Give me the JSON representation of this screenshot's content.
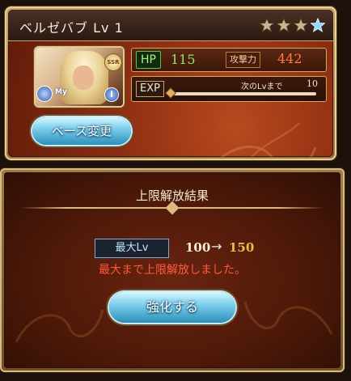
{
  "character": {
    "name": "ベルゼバブ",
    "level_text": "Lv 1",
    "stars_filled": 3,
    "stars_total": 4,
    "rarity_badge": "SSR",
    "my_badge": "My",
    "info_badge": "i"
  },
  "stats": {
    "hp_label": "HP",
    "hp_value": "115",
    "atk_label": "攻撃力",
    "atk_value": "442",
    "exp_label": "EXP",
    "next_label": "次のLvまで",
    "next_value": "10",
    "exp_progress": 0.0
  },
  "actions": {
    "base_change": "ベース変更",
    "enhance": "強化する"
  },
  "result": {
    "title": "上限解放結果",
    "max_lv_label": "最大Lv",
    "old_lv": "100",
    "arrow": "→",
    "new_lv": "150",
    "message": "最大まで上限解放しました。"
  },
  "colors": {
    "hp": "#8fe86b",
    "atk": "#ff7a47",
    "new_lv": "#f0b84a",
    "message": "#ff5a3a",
    "button": "#7dd0ee"
  }
}
